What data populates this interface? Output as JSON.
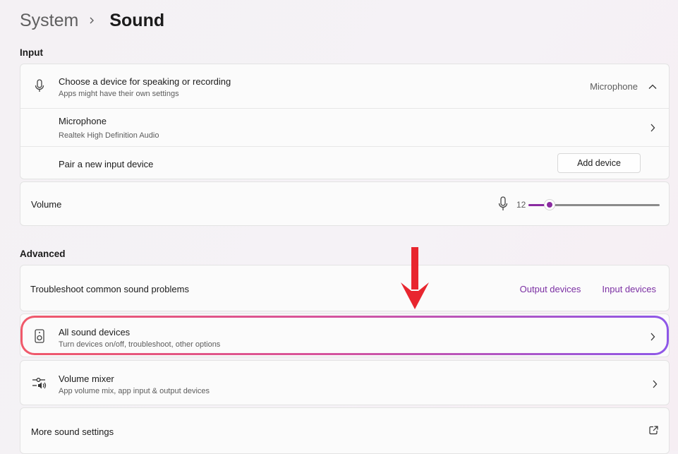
{
  "breadcrumb": {
    "root": "System",
    "current": "Sound"
  },
  "input": {
    "section_label": "Input",
    "choose_device": {
      "title": "Choose a device for speaking or recording",
      "subtitle": "Apps might have their own settings",
      "selected": "Microphone",
      "icon": "microphone-icon"
    },
    "device": {
      "title": "Microphone",
      "subtitle": "Realtek High Definition Audio"
    },
    "pair": {
      "title": "Pair a new input device",
      "button": "Add device"
    }
  },
  "volume": {
    "label": "Volume",
    "value": "12",
    "level_percent": 12
  },
  "advanced": {
    "section_label": "Advanced",
    "troubleshoot": {
      "title": "Troubleshoot common sound problems",
      "link_output": "Output devices",
      "link_input": "Input devices"
    },
    "all_devices": {
      "title": "All sound devices",
      "subtitle": "Turn devices on/off, troubleshoot, other options",
      "icon": "speaker-icon"
    },
    "mixer": {
      "title": "Volume mixer",
      "subtitle": "App volume mix, app input & output devices",
      "icon": "mixer-icon"
    },
    "more": {
      "title": "More sound settings",
      "icon": "open-external-icon"
    }
  },
  "colors": {
    "accent": "#8a2ba0",
    "arrow": "#e8262f",
    "highlight_start": "#f0596a",
    "highlight_end": "#8e57e8"
  }
}
